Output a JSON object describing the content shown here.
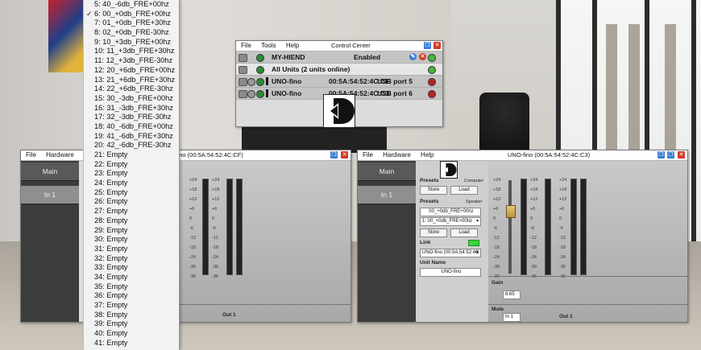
{
  "menu": {
    "items": [
      {
        "label": "5: 40_-6db_FRE+00hz",
        "checked": false
      },
      {
        "label": "6: 00_+0db_FRE+00hz",
        "checked": true
      },
      {
        "label": "7: 01_+0db_FRE+30hz",
        "checked": false
      },
      {
        "label": "8: 02_+0db_FRE-30hz",
        "checked": false
      },
      {
        "label": "9: 10_+3db_FRE+00hz",
        "checked": false
      },
      {
        "label": "10: 11_+3db_FRE+30hz",
        "checked": false
      },
      {
        "label": "11: 12_+3db_FRE-30hz",
        "checked": false
      },
      {
        "label": "12: 20_+6db_FRE+00hz",
        "checked": false
      },
      {
        "label": "13: 21_+6db_FRE+30hz",
        "checked": false
      },
      {
        "label": "14: 22_+6db_FRE-30hz",
        "checked": false
      },
      {
        "label": "15: 30_-3db_FRE+00hz",
        "checked": false
      },
      {
        "label": "16: 31_-3db_FRE+30hz",
        "checked": false
      },
      {
        "label": "17: 32_-3db_FRE-30hz",
        "checked": false
      },
      {
        "label": "18: 40_-6db_FRE+00hz",
        "checked": false
      },
      {
        "label": "19: 41_-6db_FRE+30hz",
        "checked": false
      },
      {
        "label": "20: 42_-6db_FRE-30hz",
        "checked": false
      },
      {
        "label": "21: Empty",
        "checked": false
      },
      {
        "label": "22: Empty",
        "checked": false
      },
      {
        "label": "23: Empty",
        "checked": false
      },
      {
        "label": "24: Empty",
        "checked": false
      },
      {
        "label": "25: Empty",
        "checked": false
      },
      {
        "label": "26: Empty",
        "checked": false
      },
      {
        "label": "27: Empty",
        "checked": false
      },
      {
        "label": "28: Empty",
        "checked": false
      },
      {
        "label": "29: Empty",
        "checked": false
      },
      {
        "label": "30: Empty",
        "checked": false
      },
      {
        "label": "31: Empty",
        "checked": false
      },
      {
        "label": "32: Empty",
        "checked": false
      },
      {
        "label": "33: Empty",
        "checked": false
      },
      {
        "label": "34: Empty",
        "checked": false
      },
      {
        "label": "35: Empty",
        "checked": false
      },
      {
        "label": "36: Empty",
        "checked": false
      },
      {
        "label": "37: Empty",
        "checked": false
      },
      {
        "label": "38: Empty",
        "checked": false
      },
      {
        "label": "39: Empty",
        "checked": false
      },
      {
        "label": "40: Empty",
        "checked": false
      },
      {
        "label": "41: Empty",
        "checked": false
      }
    ]
  },
  "control_center": {
    "menus": [
      "File",
      "Tools",
      "Help"
    ],
    "title": "Control Center",
    "host_row": {
      "name": "MY-HIEND",
      "status": "Enabled"
    },
    "all_units_row": {
      "label": "All Units (2 units online)"
    },
    "units": [
      {
        "name": "UNO-fino",
        "address": "00:5A:54:52:4C:CF",
        "port": "USB port 5"
      },
      {
        "name": "UNO-fino",
        "address": "00:5A:54:52:4C:C3",
        "port": "USB port 6"
      }
    ]
  },
  "left_device": {
    "menus": [
      "File",
      "Hardware",
      "H"
    ],
    "title": "-fino (00:5A:54:52:4C:CF)",
    "tabs": {
      "main": "Main",
      "in1": "In 1"
    },
    "out_label": "Out 1"
  },
  "right_device": {
    "menus": [
      "File",
      "Hardware",
      "Help"
    ],
    "title": "UNO-fino (00:5A:54:52:4C:C3)",
    "tabs": {
      "main": "Main",
      "in1": "In 1"
    },
    "presets_computer": "Presets",
    "computer_label": "Computer",
    "store_label": "Store",
    "load_label": "Load",
    "presets_speaker": "Presets",
    "speaker_label": "Speaker",
    "speaker_preset_field": "00_+0db_FRE+00hz",
    "speaker_select": "1: 00_+0db_FRE+00hz",
    "link_label": "Link",
    "link_select": "UNO-fino (00:5A:54:52:4C",
    "unit_name_label": "Unit Name",
    "unit_name_value": "UNO-fino",
    "gain_label": "Gain",
    "gain_value": "8.65",
    "mute_label": "Mute",
    "mute_value": "In 1",
    "out_label": "Out 1"
  },
  "meter_scale": [
    "+24",
    "+18",
    "+12",
    "+6",
    "0",
    "-6",
    "-12",
    "-18",
    "-24",
    "-30",
    "-36"
  ],
  "colors": {
    "accent_green": "#39d43c",
    "close_red": "#d23a2a",
    "title_blue": "#3a7fd4"
  }
}
